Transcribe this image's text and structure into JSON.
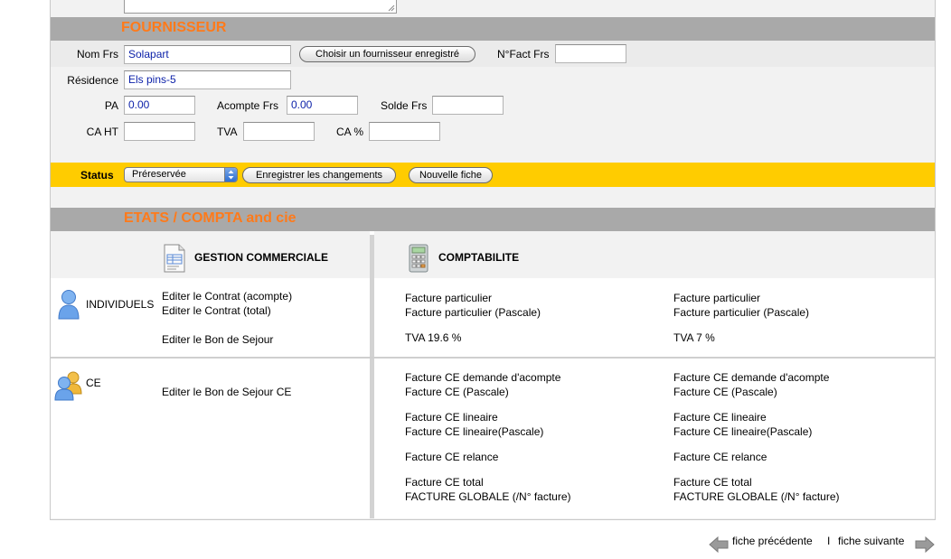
{
  "fournisseur": {
    "title": "FOURNISSEUR",
    "nom_label": "Nom Frs",
    "nom_value": "Solapart",
    "choose_button": "Choisir un fournisseur enregistré",
    "nfact_label": "N°Fact Frs",
    "nfact_value": "",
    "residence_label": "Résidence",
    "residence_value": "Els pins-5",
    "pa_label": "PA",
    "pa_value": "0.00",
    "acompte_label": "Acompte Frs",
    "acompte_value": "0.00",
    "solde_label": "Solde Frs",
    "solde_value": "",
    "caht_label": "CA HT",
    "caht_value": "",
    "tva_label": "TVA",
    "tva_value": "",
    "ca_pct_label": "CA %",
    "ca_pct_value": ""
  },
  "status": {
    "label": "Status",
    "selected": "Préreservée",
    "save_button": "Enregistrer les changements",
    "new_button": "Nouvelle fiche"
  },
  "etats": {
    "title": "ETATS / COMPTA and cie",
    "gestion_header": "GESTION COMMERCIALE",
    "compta_header": "COMPTABILITE",
    "individuels": {
      "label": "INDIVIDUELS",
      "gestion_links": [
        "Editer le Contrat (acompte)",
        "Editer le Contrat (total)",
        "Editer le Bon de Sejour"
      ],
      "compta_col1": [
        "Facture particulier",
        "Facture particulier (Pascale)",
        "TVA 19.6 %"
      ],
      "compta_col2": [
        "Facture particulier",
        "Facture particulier (Pascale)",
        "TVA 7 %"
      ]
    },
    "ce": {
      "label": "CE",
      "gestion_links": [
        "Editer le Bon de Sejour CE"
      ],
      "compta_col1": [
        "Facture CE demande d'acompte",
        "Facture CE (Pascale)",
        "Facture CE lineaire",
        "Facture CE lineaire(Pascale)",
        "Facture CE relance",
        "Facture CE total",
        "FACTURE GLOBALE (/N° facture)"
      ],
      "compta_col2": [
        "Facture CE demande d'acompte",
        "Facture CE (Pascale)",
        "Facture CE lineaire",
        "Facture CE lineaire(Pascale)",
        "Facture CE relance",
        "Facture CE total",
        "FACTURE GLOBALE (/N° facture)"
      ]
    }
  },
  "nav": {
    "prev": "fiche précédente",
    "separator": "I",
    "next": "fiche suivante"
  },
  "colors": {
    "accent": "#ff7a1a",
    "status_bar": "#ffcc00",
    "section_bar": "#a9a9a9",
    "input_text": "#0a1fa8"
  },
  "icons": [
    "document-icon",
    "calculator-icon",
    "person-icon",
    "group-icon",
    "arrow-left-icon",
    "arrow-right-icon"
  ]
}
